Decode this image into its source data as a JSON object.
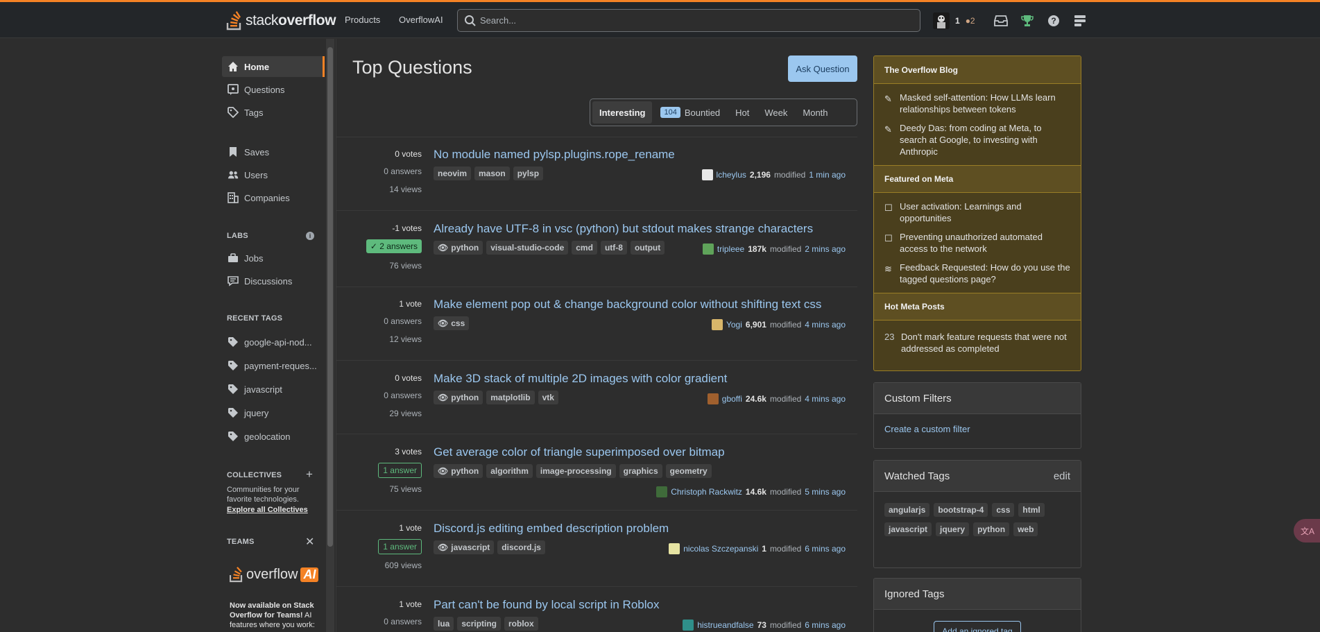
{
  "topbar": {
    "logo_stack": "stack",
    "logo_overflow": "overflow",
    "nav": [
      "Products",
      "OverflowAI"
    ],
    "search_placeholder": "Search...",
    "reputation": "1",
    "bronze_badges": "●2"
  },
  "sidebar": {
    "items": [
      {
        "label": "Home",
        "icon": "home-icon"
      },
      {
        "label": "Questions",
        "icon": "questions-icon"
      },
      {
        "label": "Tags",
        "icon": "tag-icon"
      },
      {
        "label": "Saves",
        "icon": "bookmark-icon"
      },
      {
        "label": "Users",
        "icon": "users-icon"
      },
      {
        "label": "Companies",
        "icon": "building-icon"
      }
    ],
    "labs_label": "LABS",
    "labs_items": [
      "Jobs",
      "Discussions"
    ],
    "recent_tags_label": "RECENT TAGS",
    "recent_tags": [
      "google-api-nod...",
      "payment-reques...",
      "javascript",
      "jquery",
      "geolocation"
    ],
    "collectives_label": "COLLECTIVES",
    "collectives_text": "Communities for your favorite technologies.",
    "collectives_link": "Explore all Collectives",
    "teams_label": "TEAMS",
    "ai_wordmark": "overflow",
    "ai_badge": "AI",
    "teams_text_bold": "Now available on Stack Overflow for Teams!",
    "teams_text": " AI features where you work:"
  },
  "main": {
    "title": "Top Questions",
    "ask_button": "Ask Question",
    "filters": {
      "interesting": "Interesting",
      "bounty_count": "104",
      "bountied": "Bountied",
      "hot": "Hot",
      "week": "Week",
      "month": "Month"
    },
    "questions": [
      {
        "votes": "0 votes",
        "answers": "0 answers",
        "views": "14 views",
        "title": "No module named pylsp.plugins.rope_rename",
        "tags": [
          "neovim",
          "mason",
          "pylsp"
        ],
        "user": "lcheylus",
        "rep": "2,196",
        "action": "modified",
        "time": "1 min ago"
      },
      {
        "votes": "-1 votes",
        "answers": "2 answers",
        "views": "76 views",
        "title": "Already have UTF-8 in vsc (python) but stdout makes strange characters",
        "tags": [
          "python",
          "visual-studio-code",
          "cmd",
          "utf-8",
          "output"
        ],
        "user": "tripleee",
        "rep": "187k",
        "action": "modified",
        "time": "2 mins ago"
      },
      {
        "votes": "1 vote",
        "answers": "0 answers",
        "views": "12 views",
        "title": "Make element pop out & change background color without shifting text css",
        "tags": [
          "css"
        ],
        "user": "Yogi",
        "rep": "6,901",
        "action": "modified",
        "time": "4 mins ago"
      },
      {
        "votes": "0 votes",
        "answers": "0 answers",
        "views": "29 views",
        "title": "Make 3D stack of multiple 2D images with color gradient",
        "tags": [
          "python",
          "matplotlib",
          "vtk"
        ],
        "user": "gboffi",
        "rep": "24.6k",
        "action": "modified",
        "time": "4 mins ago"
      },
      {
        "votes": "3 votes",
        "answers": "1 answer",
        "views": "75 views",
        "title": "Get average color of triangle superimposed over bitmap",
        "tags": [
          "python",
          "algorithm",
          "image-processing",
          "graphics",
          "geometry"
        ],
        "user": "Christoph Rackwitz",
        "rep": "14.6k",
        "action": "modified",
        "time": "5 mins ago"
      },
      {
        "votes": "1 vote",
        "answers": "1 answer",
        "views": "609 views",
        "title": "Discord.js editing embed description problem",
        "tags": [
          "javascript",
          "discord.js"
        ],
        "user": "nicolas Szczepanski",
        "rep": "1",
        "action": "modified",
        "time": "6 mins ago"
      },
      {
        "votes": "1 vote",
        "answers": "0 answers",
        "views": "",
        "title": "Part can't be found by local script in Roblox",
        "tags": [
          "lua",
          "scripting",
          "roblox"
        ],
        "user": "histrueandfalse",
        "rep": "73",
        "action": "modified",
        "time": "6 mins ago"
      }
    ]
  },
  "right": {
    "blog_title": "The Overflow Blog",
    "blog_items": [
      "Masked self-attention: How LLMs learn relationships between tokens",
      "Deedy Das: from coding at Meta, to search at Google, to investing with Anthropic"
    ],
    "meta_title": "Featured on Meta",
    "meta_items": [
      "User activation: Learnings and opportunities",
      "Preventing unauthorized automated access to the network",
      "Feedback Requested: How do you use the tagged questions page?"
    ],
    "hot_title": "Hot Meta Posts",
    "hot_count": "23",
    "hot_item": "Don't mark feature requests that were not addressed as completed",
    "custom_filters_title": "Custom Filters",
    "custom_filters_link": "Create a custom filter",
    "watched_title": "Watched Tags",
    "watched_edit": "edit",
    "watched_tags": [
      "angularjs",
      "bootstrap-4",
      "css",
      "html",
      "javascript",
      "jquery",
      "python",
      "web"
    ],
    "ignored_title": "Ignored Tags",
    "ignored_button": "Add an ignored tag"
  },
  "colors": {
    "accent": "#f48225",
    "link": "#9bc7ef",
    "accepted": "#5eba7d",
    "blog_bg": "#4a3f1d"
  }
}
